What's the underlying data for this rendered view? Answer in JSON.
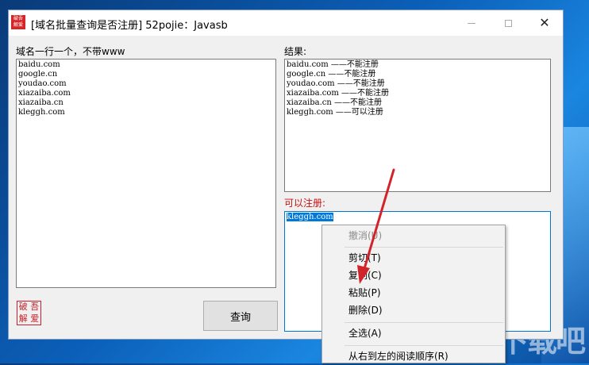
{
  "window": {
    "title": "[域名批量查询是否注册] 52pojie：Javasb",
    "icon_text": "破吾解爱",
    "close_glyph": "✕"
  },
  "left_panel": {
    "label": "域名一行一个，不带www",
    "lines": [
      "baidu.com",
      "google.cn",
      "youdao.com",
      "xiazaiba.com",
      "xiazaiba.cn",
      "kleggh.com"
    ]
  },
  "result_panel": {
    "label": "结果:",
    "lines": [
      "baidu.com ——不能注册",
      "google.cn ——不能注册",
      "youdao.com ——不能注册",
      "xiazaiba.com ——不能注册",
      "xiazaiba.cn ——不能注册",
      "kleggh.com ——可以注册"
    ]
  },
  "available_panel": {
    "label": "可以注册:",
    "selected_text": "kleggh.com"
  },
  "logo": {
    "chars": [
      "破",
      "吾",
      "解",
      "爱"
    ]
  },
  "query_button": {
    "label": "查询"
  },
  "context_menu": {
    "items": [
      {
        "label": "撤消(U)",
        "enabled": false
      },
      {
        "label": "剪切(T)",
        "enabled": true
      },
      {
        "label": "复制(C)",
        "enabled": true
      },
      {
        "label": "粘贴(P)",
        "enabled": true
      },
      {
        "label": "删除(D)",
        "enabled": true
      },
      {
        "label": "全选(A)",
        "enabled": true
      },
      {
        "label": "从右到左的阅读顺序(R)",
        "enabled": true
      }
    ]
  },
  "watermark": "下载吧",
  "colors": {
    "accent_red": "#c81010",
    "selection_blue": "#0078d7",
    "arrow_red": "#d2232a"
  }
}
